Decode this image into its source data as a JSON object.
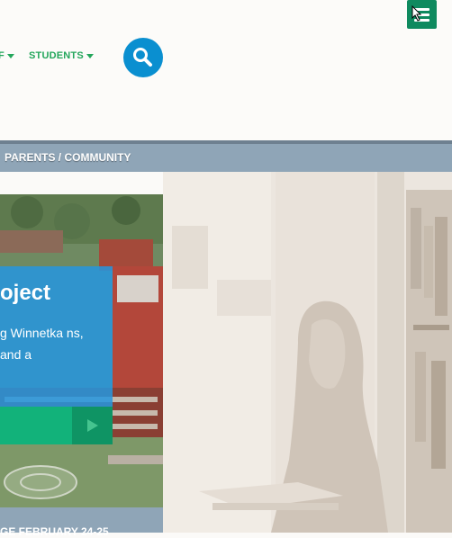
{
  "header": {
    "nav_items": [
      {
        "label": "F"
      },
      {
        "label": "STUDENTS"
      }
    ],
    "menu_icon": "hamburger-menu-icon",
    "search_icon": "search-icon"
  },
  "subnav": {
    "label": "PARENTS / COMMUNITY"
  },
  "feature_card": {
    "title": "oject",
    "text": "g Winnetka ns, and a",
    "button_icon": "play-arrow-icon"
  },
  "bottom": {
    "label": "GE FEBRUARY 24-25"
  },
  "colors": {
    "nav_green": "#23a65b",
    "search_blue": "#0a8fd0",
    "menu_green": "#0f8a5f",
    "subbar": "#8fa5b7",
    "card_blue": "#2596de",
    "card_button": "#12b27a"
  }
}
